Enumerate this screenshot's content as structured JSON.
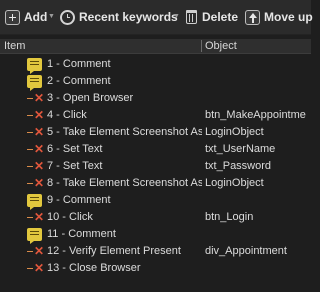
{
  "toolbar": {
    "add_label": "Add",
    "recent_label": "Recent keywords",
    "delete_label": "Delete",
    "moveup_label": "Move up"
  },
  "table": {
    "col_item": "Item",
    "col_object": "Object"
  },
  "steps": [
    {
      "kind": "comment",
      "label": "1 - Comment",
      "object": ""
    },
    {
      "kind": "comment",
      "label": "2 - Comment",
      "object": ""
    },
    {
      "kind": "action",
      "label": "3 - Open Browser",
      "object": ""
    },
    {
      "kind": "action",
      "label": "4 - Click",
      "object": "btn_MakeAppointme"
    },
    {
      "kind": "action",
      "label": "5 - Take Element Screenshot As",
      "object": "LoginObject"
    },
    {
      "kind": "action",
      "label": "6 - Set Text",
      "object": "txt_UserName"
    },
    {
      "kind": "action",
      "label": "7 - Set Text",
      "object": "txt_Password"
    },
    {
      "kind": "action",
      "label": "8 - Take Element Screenshot As",
      "object": "LoginObject"
    },
    {
      "kind": "comment",
      "label": "9 - Comment",
      "object": ""
    },
    {
      "kind": "action",
      "label": "10 - Click",
      "object": "btn_Login"
    },
    {
      "kind": "comment",
      "label": "11 - Comment",
      "object": ""
    },
    {
      "kind": "action",
      "label": "12 - Verify Element Present",
      "object": "div_Appointment"
    },
    {
      "kind": "action",
      "label": "13 - Close Browser",
      "object": ""
    }
  ]
}
